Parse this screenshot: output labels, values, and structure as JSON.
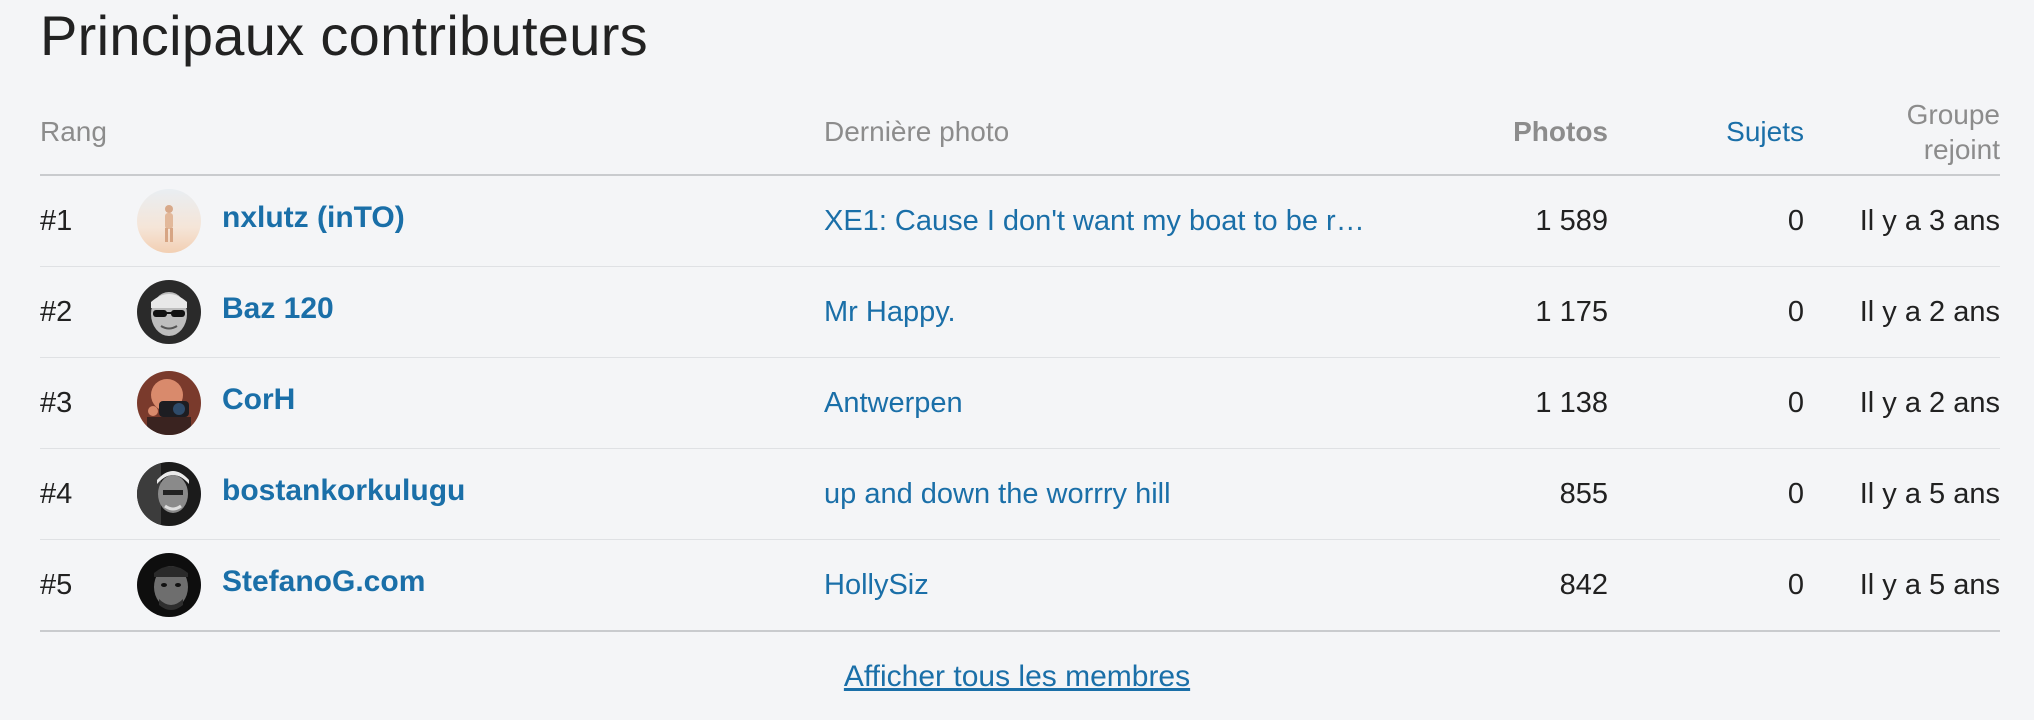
{
  "title": "Principaux contributeurs",
  "columns": {
    "rank": "Rang",
    "last_photo": "Dernière photo",
    "photos": "Photos",
    "topics": "Sujets",
    "joined": "Groupe rejoint"
  },
  "rows": [
    {
      "rank": "#1",
      "name": "nxlutz (inTO)",
      "last_photo": "XE1: Cause I don't want my boat to be r…",
      "photos": "1 589",
      "topics": "0",
      "joined": "Il y a 3 ans",
      "avatar_icon": "avatar-figure-desert"
    },
    {
      "rank": "#2",
      "name": "Baz 120",
      "last_photo": "Mr Happy.",
      "photos": "1 175",
      "topics": "0",
      "joined": "Il y a 2 ans",
      "avatar_icon": "avatar-man-sunglasses"
    },
    {
      "rank": "#3",
      "name": "CorH",
      "last_photo": "Antwerpen",
      "photos": "1 138",
      "topics": "0",
      "joined": "Il y a 2 ans",
      "avatar_icon": "avatar-man-camera"
    },
    {
      "rank": "#4",
      "name": "bostankorkulugu",
      "last_photo": "up and down the worrry hill",
      "photos": "855",
      "topics": "0",
      "joined": "Il y a 5 ans",
      "avatar_icon": "avatar-bw-portrait"
    },
    {
      "rank": "#5",
      "name": "StefanoG.com",
      "last_photo": "HollySiz",
      "photos": "842",
      "topics": "0",
      "joined": "Il y a 5 ans",
      "avatar_icon": "avatar-bw-face"
    }
  ],
  "footer_link": "Afficher tous les membres",
  "colors": {
    "link": "#1a6fa8",
    "background": "#f4f5f7",
    "header_text": "#8c8c8c"
  }
}
